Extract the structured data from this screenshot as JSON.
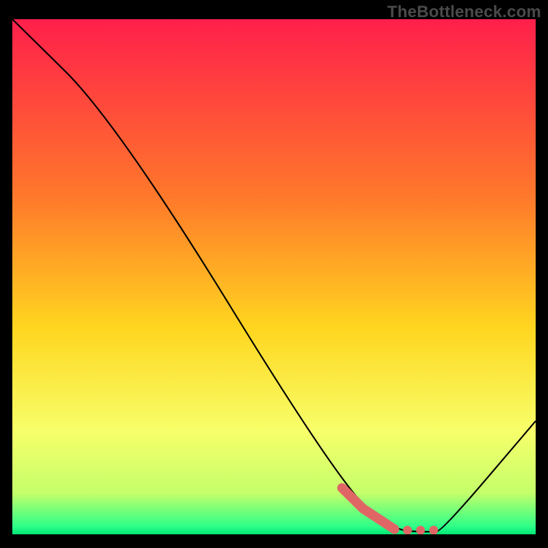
{
  "watermark": "TheBottleneck.com",
  "chart_data": {
    "type": "line",
    "title": "",
    "xlabel": "",
    "ylabel": "",
    "xlim": [
      0,
      100
    ],
    "ylim": [
      0,
      100
    ],
    "grid": false,
    "series": [
      {
        "name": "bottleneck-curve",
        "x": [
          0,
          20,
          63,
          73,
          77,
          80,
          82,
          100
        ],
        "y": [
          100,
          80,
          9,
          1,
          0.5,
          0.5,
          0.5,
          22
        ]
      }
    ],
    "highlight": {
      "name": "optimal-range",
      "color": "#e06666",
      "points_x": [
        63,
        67,
        70,
        73,
        75.5,
        78,
        80.5
      ],
      "points_y": [
        9,
        5,
        3,
        1,
        0.8,
        0.8,
        0.8
      ]
    },
    "gradient_stops": [
      {
        "offset": 0.0,
        "color": "#ff1f4b"
      },
      {
        "offset": 0.35,
        "color": "#ff7a2a"
      },
      {
        "offset": 0.6,
        "color": "#ffd61f"
      },
      {
        "offset": 0.8,
        "color": "#f7ff6a"
      },
      {
        "offset": 0.92,
        "color": "#c4ff6a"
      },
      {
        "offset": 0.985,
        "color": "#2dff88"
      },
      {
        "offset": 1.0,
        "color": "#00e676"
      }
    ]
  }
}
